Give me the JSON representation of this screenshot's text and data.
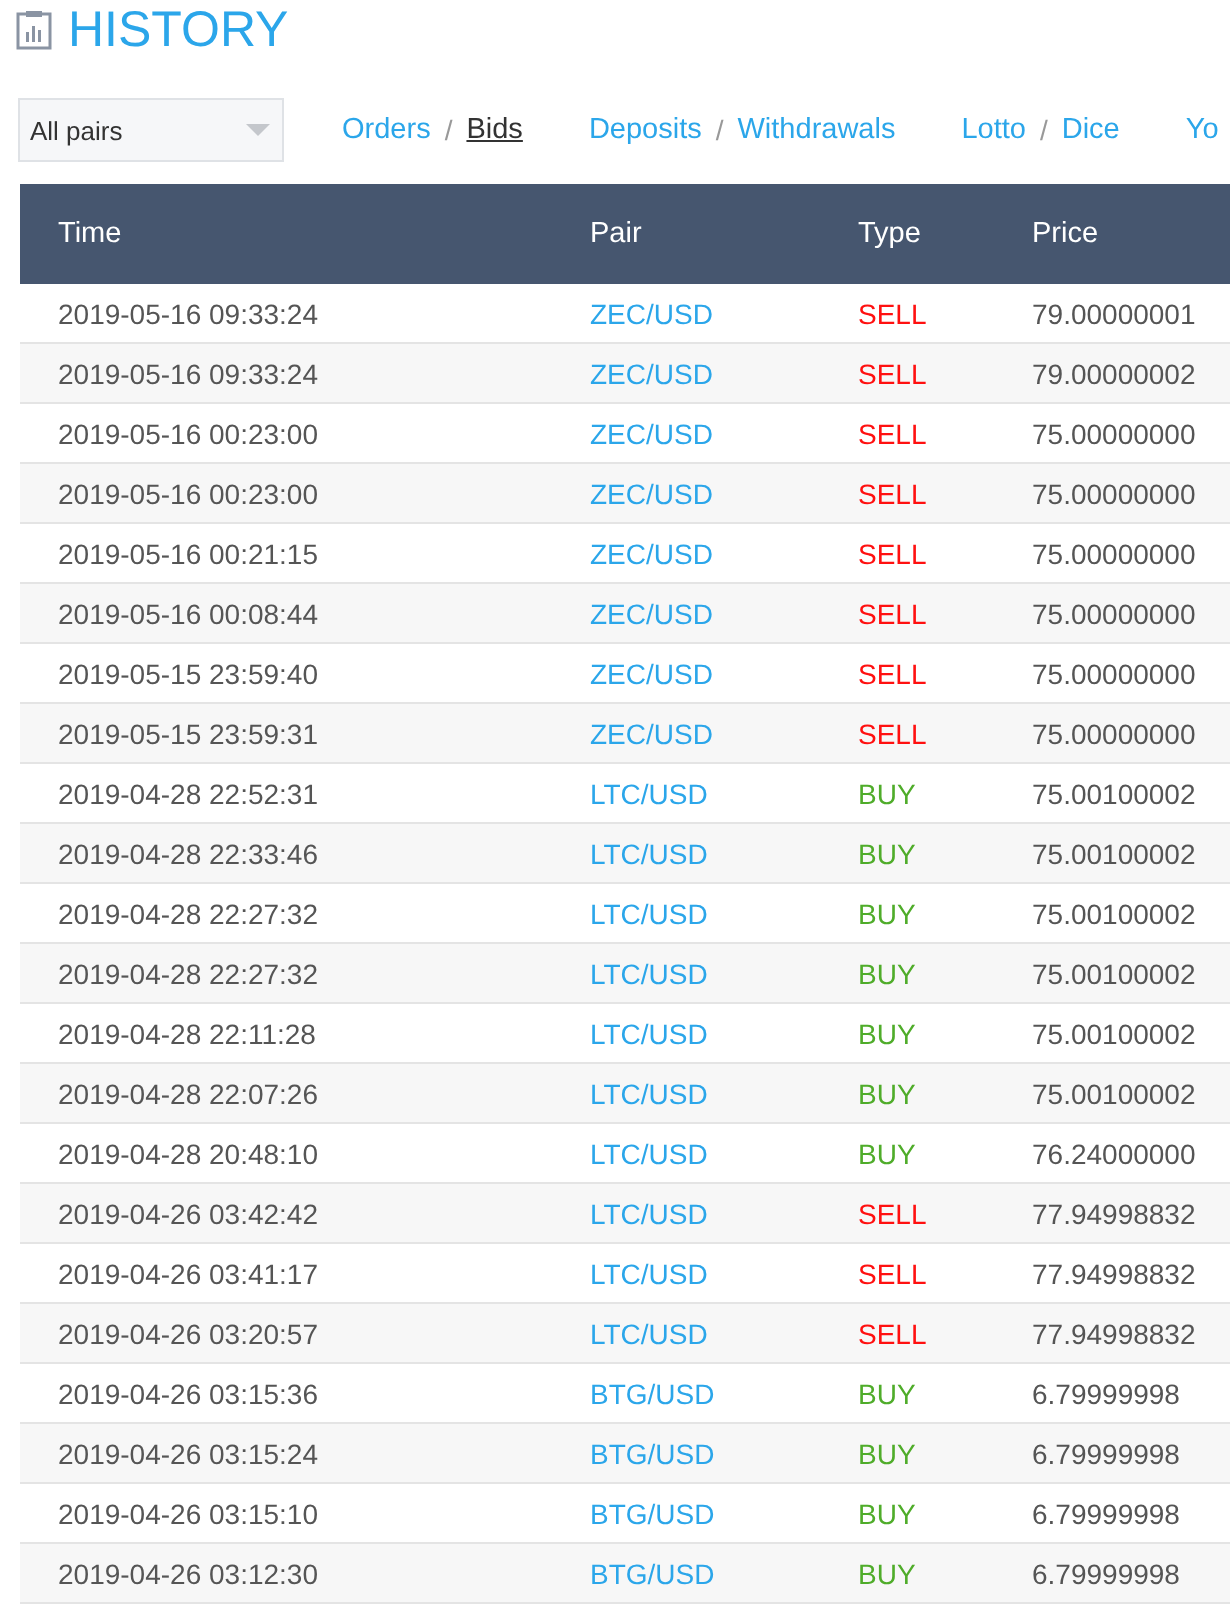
{
  "page": {
    "title": "HISTORY"
  },
  "filter": {
    "value": "All pairs"
  },
  "nav": [
    {
      "separator": "/",
      "links": [
        {
          "label": "Orders",
          "selected": false
        },
        {
          "label": "Bids",
          "selected": true
        }
      ]
    },
    {
      "separator": "/",
      "links": [
        {
          "label": "Deposits",
          "selected": false
        },
        {
          "label": "Withdrawals",
          "selected": false
        }
      ]
    },
    {
      "separator": "/",
      "links": [
        {
          "label": "Lotto",
          "selected": false
        },
        {
          "label": "Dice",
          "selected": false
        }
      ]
    },
    {
      "links": [
        {
          "label": "Yo",
          "selected": false
        }
      ]
    }
  ],
  "table": {
    "columns": [
      "Time",
      "Pair",
      "Type",
      "Price"
    ],
    "rows": [
      {
        "time": "2019-05-16 09:33:24",
        "pair": "ZEC/USD",
        "type": "SELL",
        "kind": "sell",
        "price": "79.00000001"
      },
      {
        "time": "2019-05-16 09:33:24",
        "pair": "ZEC/USD",
        "type": "SELL",
        "kind": "sell",
        "price": "79.00000002"
      },
      {
        "time": "2019-05-16 00:23:00",
        "pair": "ZEC/USD",
        "type": "SELL",
        "kind": "sell",
        "price": "75.00000000"
      },
      {
        "time": "2019-05-16 00:23:00",
        "pair": "ZEC/USD",
        "type": "SELL",
        "kind": "sell",
        "price": "75.00000000"
      },
      {
        "time": "2019-05-16 00:21:15",
        "pair": "ZEC/USD",
        "type": "SELL",
        "kind": "sell",
        "price": "75.00000000"
      },
      {
        "time": "2019-05-16 00:08:44",
        "pair": "ZEC/USD",
        "type": "SELL",
        "kind": "sell",
        "price": "75.00000000"
      },
      {
        "time": "2019-05-15 23:59:40",
        "pair": "ZEC/USD",
        "type": "SELL",
        "kind": "sell",
        "price": "75.00000000"
      },
      {
        "time": "2019-05-15 23:59:31",
        "pair": "ZEC/USD",
        "type": "SELL",
        "kind": "sell",
        "price": "75.00000000"
      },
      {
        "time": "2019-04-28 22:52:31",
        "pair": "LTC/USD",
        "type": "BUY",
        "kind": "buy",
        "price": "75.00100002"
      },
      {
        "time": "2019-04-28 22:33:46",
        "pair": "LTC/USD",
        "type": "BUY",
        "kind": "buy",
        "price": "75.00100002"
      },
      {
        "time": "2019-04-28 22:27:32",
        "pair": "LTC/USD",
        "type": "BUY",
        "kind": "buy",
        "price": "75.00100002"
      },
      {
        "time": "2019-04-28 22:27:32",
        "pair": "LTC/USD",
        "type": "BUY",
        "kind": "buy",
        "price": "75.00100002"
      },
      {
        "time": "2019-04-28 22:11:28",
        "pair": "LTC/USD",
        "type": "BUY",
        "kind": "buy",
        "price": "75.00100002"
      },
      {
        "time": "2019-04-28 22:07:26",
        "pair": "LTC/USD",
        "type": "BUY",
        "kind": "buy",
        "price": "75.00100002"
      },
      {
        "time": "2019-04-28 20:48:10",
        "pair": "LTC/USD",
        "type": "BUY",
        "kind": "buy",
        "price": "76.24000000"
      },
      {
        "time": "2019-04-26 03:42:42",
        "pair": "LTC/USD",
        "type": "SELL",
        "kind": "sell",
        "price": "77.94998832"
      },
      {
        "time": "2019-04-26 03:41:17",
        "pair": "LTC/USD",
        "type": "SELL",
        "kind": "sell",
        "price": "77.94998832"
      },
      {
        "time": "2019-04-26 03:20:57",
        "pair": "LTC/USD",
        "type": "SELL",
        "kind": "sell",
        "price": "77.94998832"
      },
      {
        "time": "2019-04-26 03:15:36",
        "pair": "BTG/USD",
        "type": "BUY",
        "kind": "buy",
        "price": "6.79999998"
      },
      {
        "time": "2019-04-26 03:15:24",
        "pair": "BTG/USD",
        "type": "BUY",
        "kind": "buy",
        "price": "6.79999998"
      },
      {
        "time": "2019-04-26 03:15:10",
        "pair": "BTG/USD",
        "type": "BUY",
        "kind": "buy",
        "price": "6.79999998"
      },
      {
        "time": "2019-04-26 03:12:30",
        "pair": "BTG/USD",
        "type": "BUY",
        "kind": "buy",
        "price": "6.79999998"
      }
    ]
  }
}
